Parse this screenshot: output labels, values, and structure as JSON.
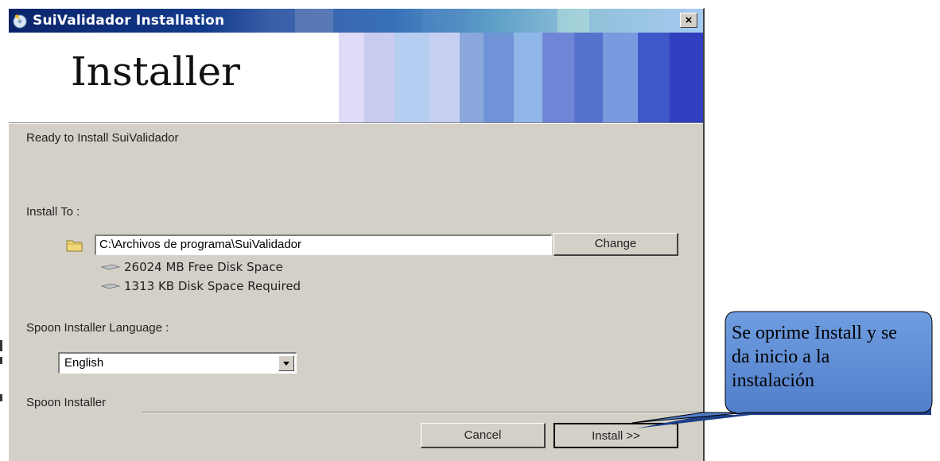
{
  "window": {
    "title": "SuiValidador Installation",
    "close_glyph": "×"
  },
  "banner": {
    "title": "Installer"
  },
  "content": {
    "ready_text": "Ready to Install SuiValidador",
    "install_to_label": "Install To :",
    "install_path": "C:\\Archivos de programa\\SuiValidador",
    "change_label": "Change",
    "free_space": "26024 MB Free Disk Space",
    "required_space": "1313 KB Disk Space Required",
    "language_label": "Spoon Installer Language :",
    "language_value": "English"
  },
  "footer": {
    "brand": "Spoon Installer",
    "cancel_label": "Cancel",
    "install_label": "Install >>"
  },
  "callout": {
    "text": "Se oprime Install y se da inicio a la instalación"
  },
  "colors": {
    "dialog_bg": "#d4d0c8",
    "callout_fill": "#5f8fd6",
    "title_blue": "#0a246a"
  }
}
